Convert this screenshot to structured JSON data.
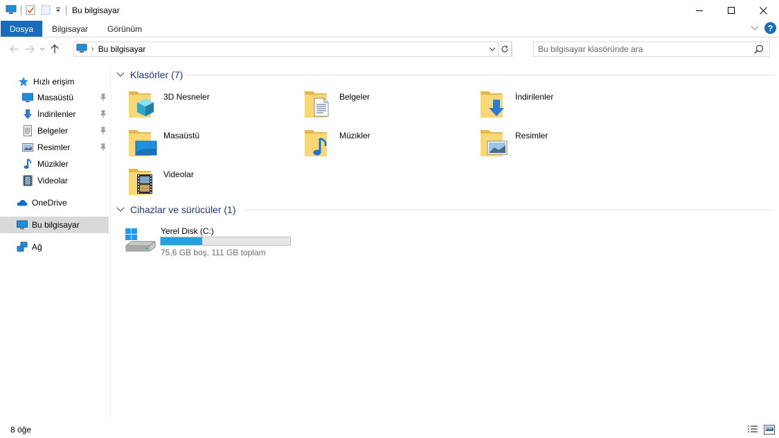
{
  "window": {
    "title": "Bu bilgisayar",
    "minimize_glyph": "—",
    "maximize_glyph": "☐",
    "close_glyph": "✕"
  },
  "ribbon": {
    "tabs": [
      "Dosya",
      "Bilgisayar",
      "Görünüm"
    ],
    "help_glyph": "?"
  },
  "address": {
    "path": "Bu bilgisayar",
    "search_placeholder": "Bu bilgisayar klasöründe ara"
  },
  "sidebar": {
    "quick_access": "Hızlı erişim",
    "quick_items": [
      "Masaüstü",
      "İndirilenler",
      "Belgeler",
      "Resimler",
      "Müzikler",
      "Videolar"
    ],
    "onedrive": "OneDrive",
    "this_pc": "Bu bilgisayar",
    "network": "Ağ"
  },
  "folders_group": {
    "title": "Klasörler (7)",
    "items": [
      "3D Nesneler",
      "Belgeler",
      "İndirilenler",
      "Masaüstü",
      "Müzikler",
      "Resimler",
      "Videolar"
    ]
  },
  "devices_group": {
    "title": "Cihazlar ve sürücüler (1)",
    "drive": {
      "name": "Yerel Disk (C:)",
      "details": "75,6 GB boş, 111 GB toplam",
      "used_fraction": 0.32
    }
  },
  "status": {
    "count": "8 öğe"
  },
  "colors": {
    "accent": "#1a6bb8",
    "group_header": "#1e3287",
    "drive_fill": "#26a0da",
    "folder": "#f8d775"
  }
}
